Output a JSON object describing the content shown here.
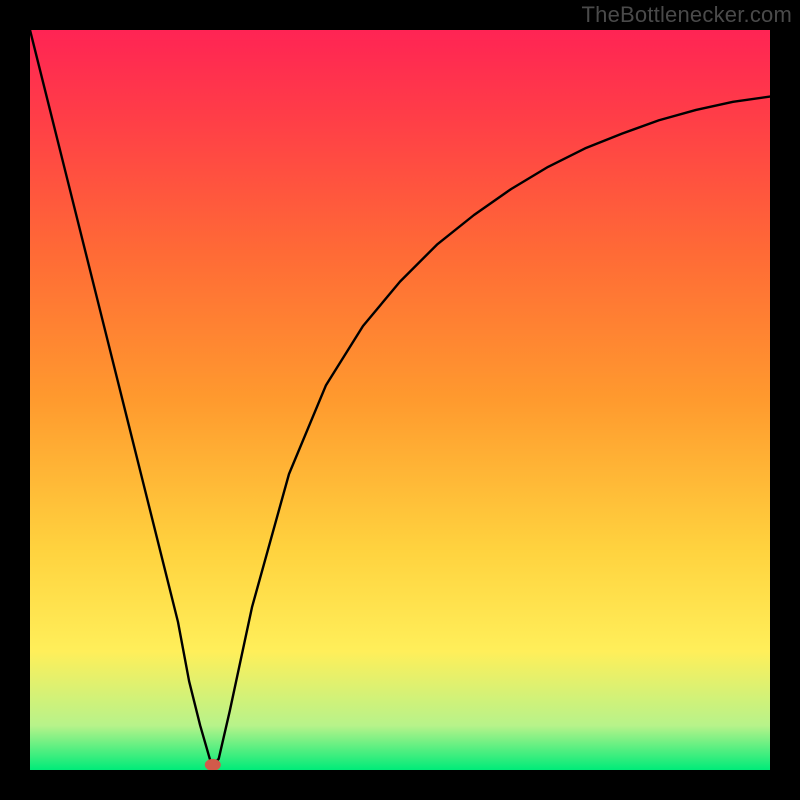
{
  "watermark": "TheBottlenecker.com",
  "colors": {
    "black": "#000000",
    "curveStroke": "#000000",
    "markerFill": "#d15a4a",
    "greenBottom": "#00eb79",
    "paleGreen": "#b7f38a",
    "yellow": "#ffef5a",
    "gold": "#ffd23e",
    "orange": "#ff9a2e",
    "orangeRed": "#ff6a36",
    "redMid": "#ff3e47",
    "redTop": "#ff2454"
  },
  "chart_data": {
    "type": "line",
    "title": "",
    "xlabel": "",
    "ylabel": "",
    "xlim": [
      0,
      100
    ],
    "ylim": [
      0,
      100
    ],
    "series": [
      {
        "name": "bottleneck-curve",
        "x": [
          0,
          5,
          10,
          15,
          18,
          20,
          21.5,
          23,
          24.3,
          24.7,
          25.5,
          27,
          30,
          35,
          40,
          45,
          50,
          55,
          60,
          65,
          70,
          75,
          80,
          85,
          90,
          95,
          100
        ],
        "y": [
          100,
          80,
          60,
          40,
          28,
          20,
          12,
          6,
          1.5,
          0.7,
          1.5,
          8,
          22,
          40,
          52,
          60,
          66,
          71,
          75,
          78.5,
          81.5,
          84,
          86,
          87.8,
          89.2,
          90.3,
          91.0
        ]
      }
    ],
    "marker": {
      "x": 24.7,
      "y": 0.7,
      "name": "optimal-point"
    },
    "grid": false,
    "legend": false
  }
}
